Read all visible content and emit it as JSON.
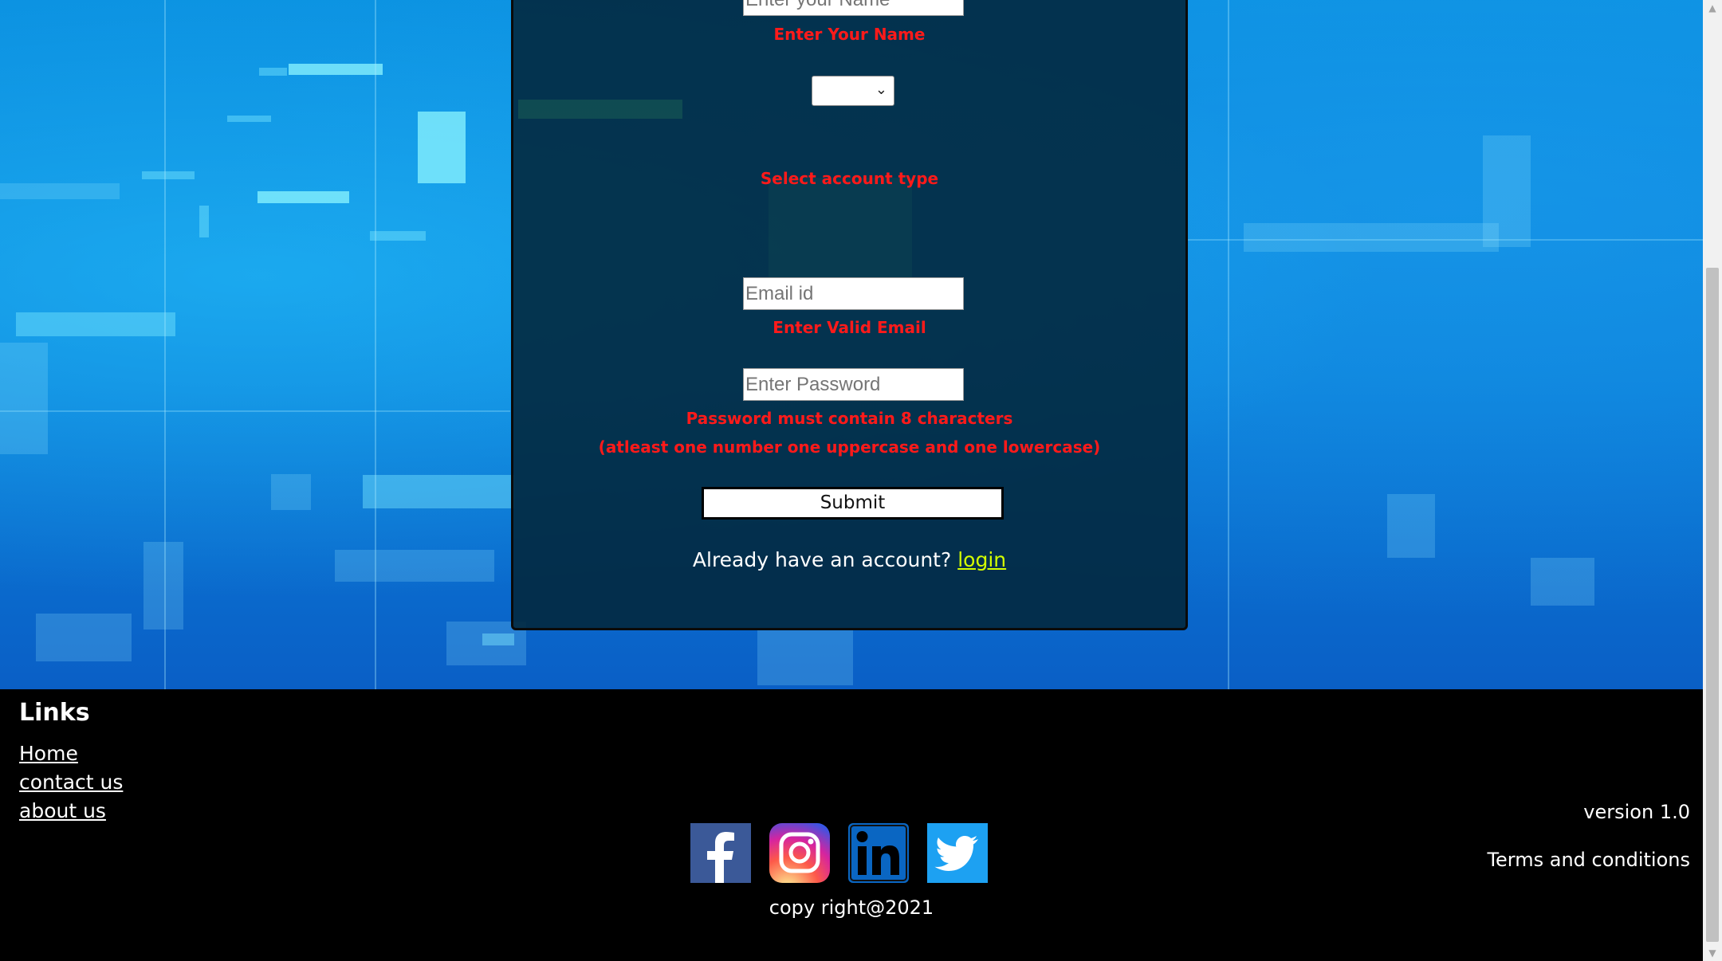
{
  "form": {
    "name_placeholder": "Enter your Name",
    "name_error": "Enter Your Name",
    "account_type_value": "",
    "account_type_error": "Select account type",
    "email_placeholder": "Email id",
    "email_error": "Enter Valid Email",
    "password_placeholder": "Enter Password",
    "password_error_line1": "Password must contain 8 characters",
    "password_error_line2": "(atleast one number one uppercase and one lowercase)",
    "submit_label": "Submit",
    "login_prompt": "Already have an account?",
    "login_link": "login"
  },
  "footer": {
    "links_heading": "Links",
    "links": [
      "Home",
      "contact us",
      "about us"
    ],
    "social": [
      "facebook-icon",
      "instagram-icon",
      "linkedin-icon",
      "twitter-icon"
    ],
    "copyright": "copy right@2021",
    "version": "version 1.0",
    "terms": "Terms and conditions"
  },
  "colors": {
    "error": "#ff1a1a",
    "login_link": "#d4ff00",
    "card_bg": "#02283e",
    "footer_bg": "#000000"
  }
}
